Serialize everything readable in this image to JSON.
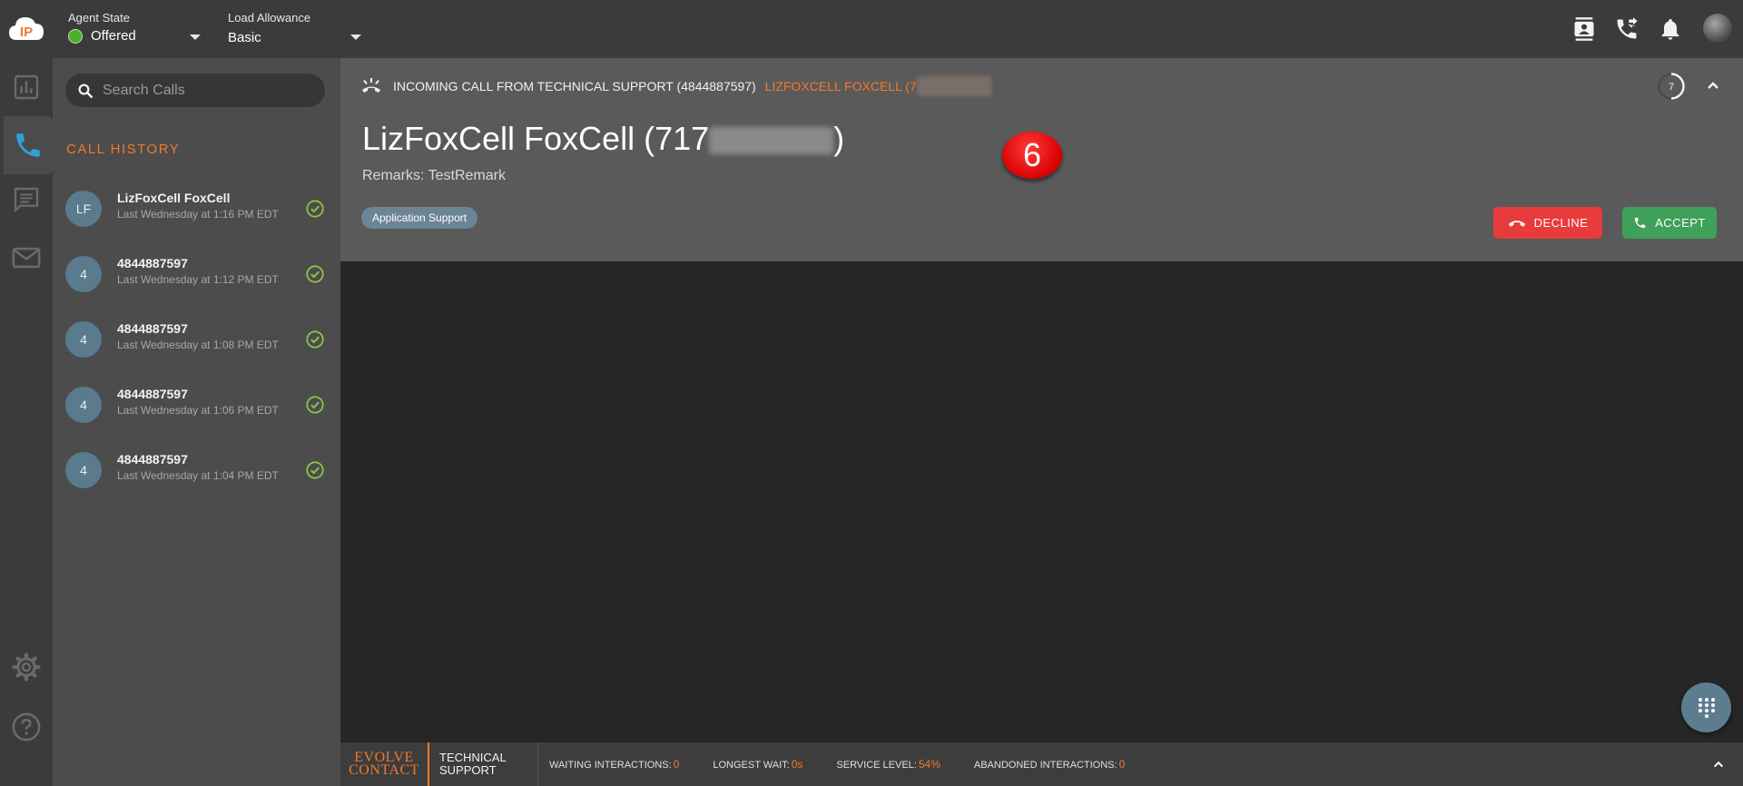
{
  "topbar": {
    "logo_text": "IP",
    "agent_state_label": "Agent State",
    "agent_state_value": "Offered",
    "load_allowance_label": "Load Allowance",
    "load_allowance_value": "Basic"
  },
  "sidebar": {
    "search_placeholder": "Search Calls",
    "section_title": "CALL HISTORY",
    "calls": [
      {
        "avatar": "LF",
        "name": "LizFoxCell FoxCell",
        "time": "Last Wednesday at 1:16 PM EDT"
      },
      {
        "avatar": "4",
        "name": "4844887597",
        "time": "Last Wednesday at 1:12 PM EDT"
      },
      {
        "avatar": "4",
        "name": "4844887597",
        "time": "Last Wednesday at 1:08 PM EDT"
      },
      {
        "avatar": "4",
        "name": "4844887597",
        "time": "Last Wednesday at 1:06 PM EDT"
      },
      {
        "avatar": "4",
        "name": "4844887597",
        "time": "Last Wednesday at 1:04 PM EDT"
      }
    ]
  },
  "incoming": {
    "title": "INCOMING CALL FROM TECHNICAL SUPPORT (4844887597)",
    "caller_short": "LIZFOXCELL FOXCELL (7",
    "caller_name_prefix": "LizFoxCell FoxCell (717",
    "caller_name_suffix": ")",
    "remarks": "Remarks: TestRemark",
    "skill_chip": "Application Support",
    "timer": "7",
    "decline_label": "DECLINE",
    "accept_label": "ACCEPT"
  },
  "annotation_badge": "6",
  "bottombar": {
    "brand_line1": "EVOLVE",
    "brand_line2": "CONTACT",
    "queue_line1": "TECHNICAL",
    "queue_line2": "SUPPORT",
    "stats": [
      {
        "label": "WAITING INTERACTIONS:",
        "value": "0"
      },
      {
        "label": "LONGEST WAIT:",
        "value": "0s"
      },
      {
        "label": "SERVICE LEVEL:",
        "value": "54%"
      },
      {
        "label": "ABANDONED INTERACTIONS:",
        "value": "0"
      }
    ]
  },
  "colors": {
    "accent_orange": "#f07a2a",
    "online_green": "#4caf2a",
    "decline_red": "#e83b3b",
    "accept_green": "#3fa05a"
  }
}
